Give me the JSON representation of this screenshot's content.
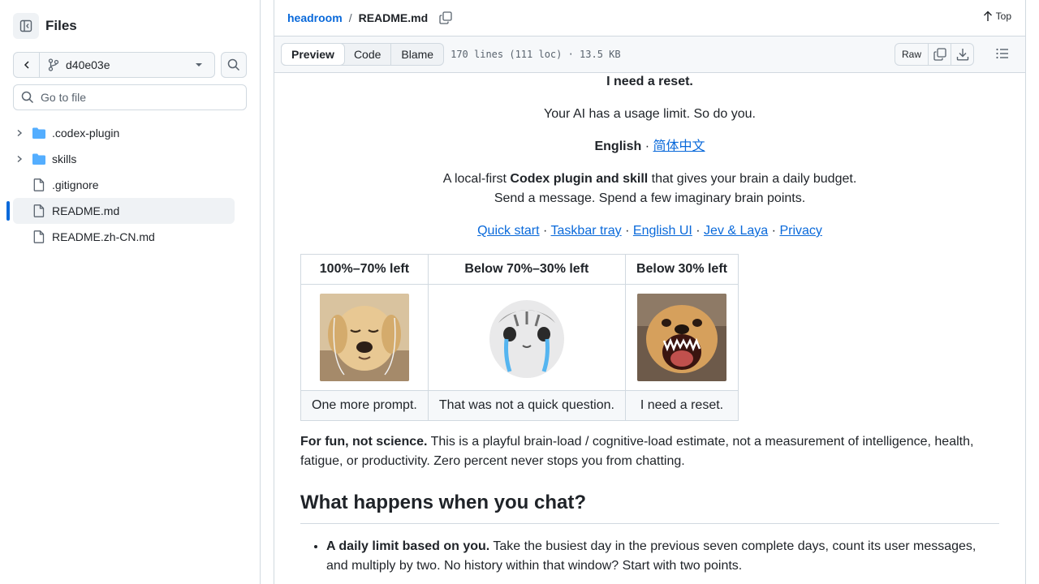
{
  "sidebar": {
    "title": "Files",
    "branch": "d40e03e",
    "search_placeholder": "Go to file",
    "items": [
      {
        "label": ".codex-plugin",
        "type": "folder"
      },
      {
        "label": "skills",
        "type": "folder"
      },
      {
        "label": ".gitignore",
        "type": "file"
      },
      {
        "label": "README.md",
        "type": "file",
        "active": true
      },
      {
        "label": "README.zh-CN.md",
        "type": "file"
      }
    ]
  },
  "header": {
    "repo": "headroom",
    "separator": "/",
    "file": "README.md",
    "top_label": "Top"
  },
  "filebar": {
    "tabs": [
      "Preview",
      "Code",
      "Blame"
    ],
    "info": "170 lines (111 loc) · 13.5 KB",
    "raw_label": "Raw"
  },
  "article": {
    "line1": "I need a reset.",
    "line2": "Your AI has a usage limit. So do you.",
    "lang_current": "English",
    "lang_dot": "·",
    "lang_other": "简体中文",
    "intro_a": "A local-first ",
    "intro_b": "Codex plugin and skill",
    "intro_c": " that gives your brain a daily budget.",
    "intro_d": "Send a message. Spend a few imaginary brain points.",
    "links": [
      "Quick start",
      "Taskbar tray",
      "English UI",
      "Jev & Laya",
      "Privacy"
    ],
    "link_sep": "·",
    "table": {
      "headers": [
        "100%–70% left",
        "Below 70%–30% left",
        "Below 30% left"
      ],
      "captions": [
        "One more prompt.",
        "That was not a quick question.",
        "I need a reset."
      ]
    },
    "fun_bold": "For fun, not science.",
    "fun_text": " This is a playful brain-load / cognitive-load estimate, not a measurement of intelligence, health, fatigue, or productivity. Zero percent never stops you from chatting.",
    "h2": "What happens when you chat?",
    "bullet1_bold": "A daily limit based on you.",
    "bullet1_text": " Take the busiest day in the previous seven complete days, count its user messages, and multiply by two. No history within that window? Start with two points."
  },
  "colors": {
    "accent": "#0969da",
    "border": "#d1d9e0",
    "folder": "#54aeff"
  }
}
